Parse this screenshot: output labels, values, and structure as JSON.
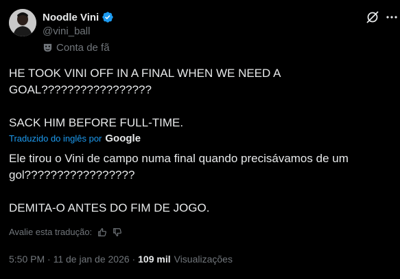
{
  "author": {
    "name": "Noodle Vini",
    "handle": "@vini_ball",
    "label": "Conta de fã"
  },
  "icons": {
    "verified": "verified-badge-icon",
    "fan": "theater-mask-icon",
    "grok": "grok-icon",
    "more": "more-options-icon",
    "like": "thumbs-up-icon",
    "dislike": "thumbs-down-icon"
  },
  "tweet": {
    "original_line1": "HE TOOK VINI OFF IN A FINAL WHEN WE NEED A GOAL?????????????????",
    "original_line2": "SACK HIM BEFORE FULL-TIME.",
    "translated_by": "Traduzido do inglês por",
    "translator_brand": "Google",
    "translated_line1": "Ele tirou o Vini de campo numa final quando precisávamos de um gol?????????????????",
    "translated_line2": "DEMITA-O ANTES DO FIM DE JOGO."
  },
  "rating": {
    "prompt": "Avalie esta tradução:"
  },
  "meta": {
    "time": "5:50 PM",
    "sep1": " · ",
    "date": "11 de jan de 2026",
    "sep2": " · ",
    "views_count": "109 mil",
    "views_label": "Visualizações"
  },
  "colors": {
    "background": "#000000",
    "text": "#e7e9ea",
    "muted": "#71767b",
    "link": "#1d9bf0",
    "verified": "#1d9bf0"
  }
}
